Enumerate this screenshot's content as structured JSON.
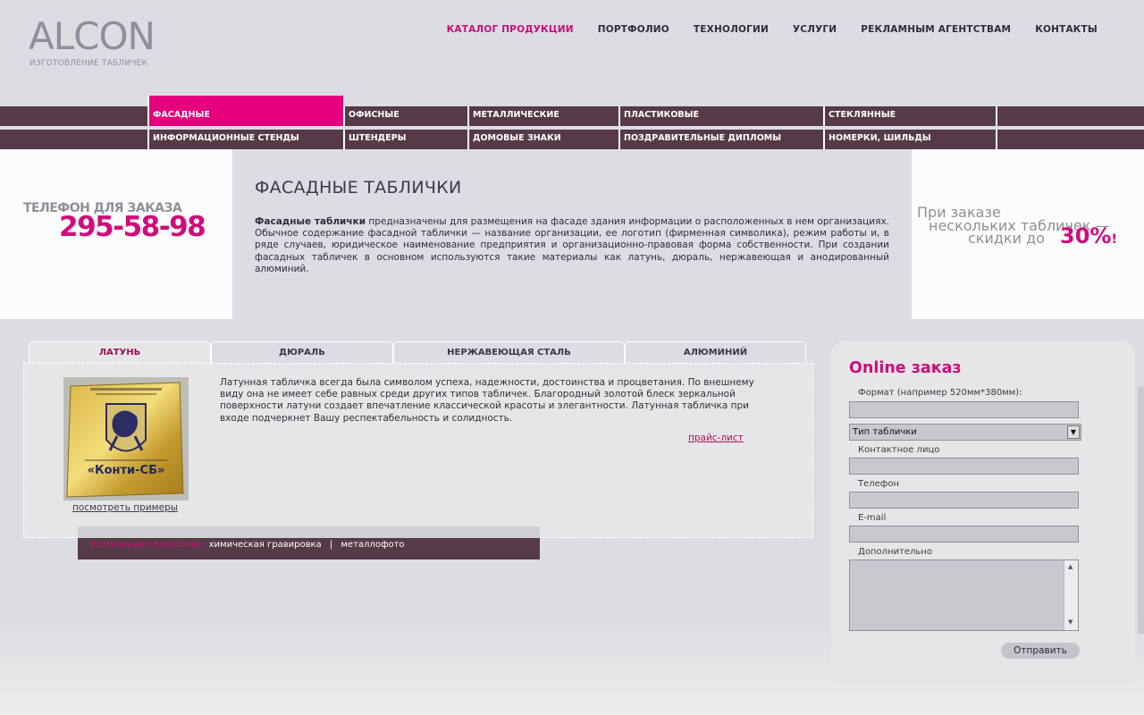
{
  "logo": {
    "name": "ALCON",
    "tagline": "ИЗГОТОВЛЕНИЕ ТАБЛИЧЕК"
  },
  "topnav": [
    {
      "label": "КАТАЛОГ ПРОДУКЦИИ",
      "active": true
    },
    {
      "label": "ПОРТФОЛИО"
    },
    {
      "label": "ТЕХНОЛОГИИ"
    },
    {
      "label": "УСЛУГИ"
    },
    {
      "label": "РЕКЛАМНЫМ АГЕНТСТВАМ"
    },
    {
      "label": "КОНТАКТЫ"
    }
  ],
  "categories_row1": [
    "ФАСАДНЫЕ",
    "ОФИСНЫЕ",
    "МЕТАЛЛИЧЕСКИЕ",
    "ПЛАСТИКОВЫЕ",
    "СТЕКЛЯННЫЕ"
  ],
  "categories_row2": [
    "ИНФОРМАЦИОННЫЕ СТЕНДЫ",
    "ШТЕНДЕРЫ",
    "ДОМОВЫЕ ЗНАКИ",
    "ПОЗДРАВИТЕЛЬНЫЕ ДИПЛОМЫ",
    "НОМЕРКИ, ШИЛЬДЫ"
  ],
  "active_category": "ФАСАДНЫЕ",
  "phone": {
    "label": "ТЕЛЕФОН ДЛЯ ЗАКАЗА",
    "number": "295-58-98"
  },
  "page_title": "ФАСАДНЫЕ ТАБЛИЧКИ",
  "intro": {
    "bold": "Фасадные таблички",
    "text": " предназначены для размещения на фасаде здания информации о расположенных в нем организациях. Обычное содержание фасадной таблички — название организации, ее логотип (фирменная символика), режим работы и, в ряде случаев, юридическое наименование предприятия и организационно-правовая форма собственности. При создании фасадных табличек в основном используются такие материалы как  латунь, дюраль, нержавеющая и анодированный алюминий."
  },
  "promo": {
    "line1": "При заказе",
    "line2": "нескольких табличек —",
    "line3": "скидки до",
    "percent": "30%",
    "mark": "!"
  },
  "tabs": [
    {
      "label": "ЛАТУНЬ",
      "active": true
    },
    {
      "label": "ДЮРАЛЬ"
    },
    {
      "label": "НЕРЖАВЕЮЩАЯ СТАЛЬ"
    },
    {
      "label": "АЛЮМИНИЙ"
    }
  ],
  "tab_content": {
    "photo_caption": "«Конти-СБ»",
    "examples_link": "посмотреть примеры",
    "text": "Латунная табличка всегда была символом успеха, надежности, достоинства и процветания. По внешнему виду она не имеет себе равных среди других типов табличек. Благородный золотой блеск зеркальной поверхности латуни создает впечатление классической красоты и элегантности. Латунная табличка при входе подчеркнет Вашу респектабельность и солидность.",
    "price_link": "прайс-лист",
    "tech_label": "Возможные технологии:",
    "tech_items": [
      "химическая гравировка",
      "металлофото"
    ],
    "tech_sep": "|"
  },
  "order_form": {
    "title": "Online заказ",
    "format_label": "Формат (например 520мм*380мм):",
    "type_select": "Тип таблички",
    "contact_label": "Контактное лицо",
    "phone_label": "Телефон",
    "email_label": "E-mail",
    "extra_label": "Дополнительно",
    "submit": "Отправить"
  },
  "colors": {
    "accent": "#e5007d",
    "accent_text": "#cc0d7a",
    "bar": "#563a47",
    "bg": "#dcdde2"
  }
}
